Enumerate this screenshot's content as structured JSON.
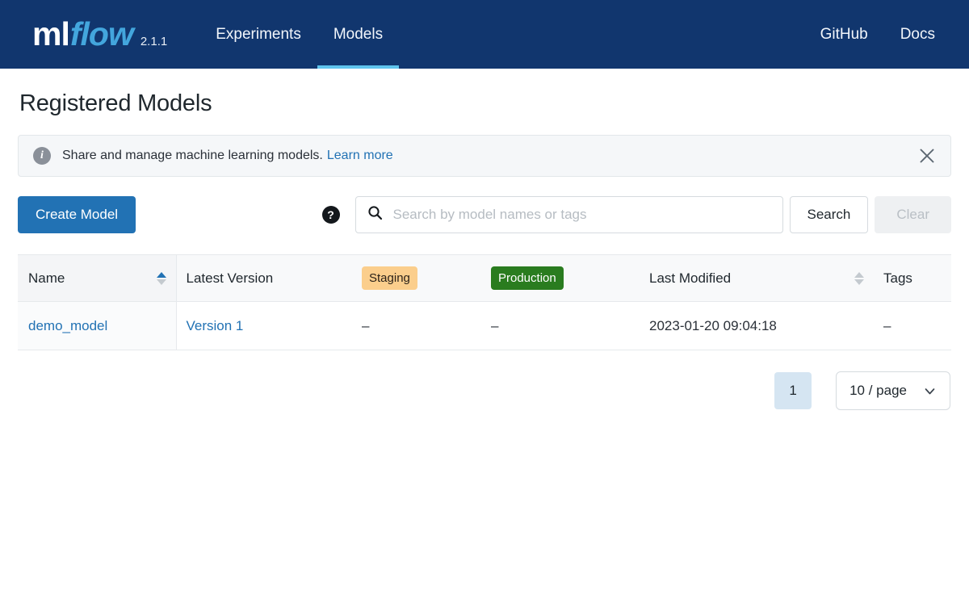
{
  "header": {
    "logo_ml": "ml",
    "logo_flow": "flow",
    "version": "2.1.1",
    "tabs": [
      {
        "label": "Experiments",
        "active": false
      },
      {
        "label": "Models",
        "active": true
      }
    ],
    "links": [
      {
        "label": "GitHub"
      },
      {
        "label": "Docs"
      }
    ]
  },
  "page": {
    "title": "Registered Models"
  },
  "banner": {
    "icon": "info-icon",
    "text": "Share and manage machine learning models.",
    "link_label": "Learn more",
    "close_icon": "close-icon"
  },
  "toolbar": {
    "create_label": "Create Model",
    "help_icon": "question-mark-icon",
    "search_icon": "search-icon",
    "search_value": "",
    "search_placeholder": "Search by model names or tags",
    "search_label": "Search",
    "clear_label": "Clear",
    "clear_disabled": true
  },
  "table": {
    "columns": [
      {
        "label": "Name",
        "sortable": true,
        "sort": "asc",
        "type": "text"
      },
      {
        "label": "Latest Version",
        "sortable": false,
        "type": "text"
      },
      {
        "label": "Staging",
        "sortable": false,
        "type": "badge",
        "badge_style": "staging"
      },
      {
        "label": "Production",
        "sortable": false,
        "type": "badge",
        "badge_style": "production"
      },
      {
        "label": "Last Modified",
        "sortable": true,
        "sort": "none",
        "type": "text"
      },
      {
        "label": "Tags",
        "sortable": false,
        "type": "text"
      }
    ],
    "rows": [
      {
        "name": "demo_model",
        "latest_version": "Version 1",
        "staging": "–",
        "production": "–",
        "last_modified": "2023-01-20 09:04:18",
        "tags": "–"
      }
    ]
  },
  "pagination": {
    "current_page": "1",
    "page_size_label": "10 / page",
    "chevron_icon": "chevron-down-icon"
  },
  "colors": {
    "header_bg": "#11366e",
    "accent_blue": "#2272b4",
    "tab_underline": "#5fc4ed",
    "logo_flow": "#43a6dd",
    "staging_badge": "#fbce8c",
    "production_badge": "#2a7c1f",
    "page_active": "#d5e5f2"
  }
}
